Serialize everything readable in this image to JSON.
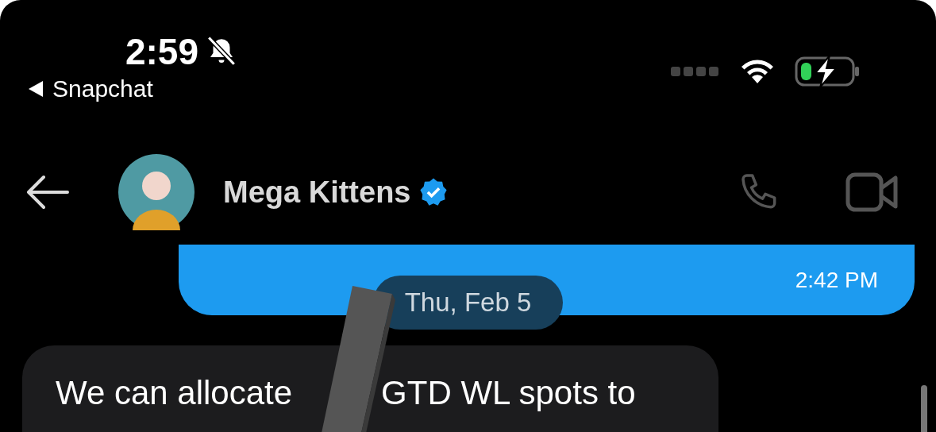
{
  "status_bar": {
    "time": "2:59",
    "back_app": "Snapchat"
  },
  "header": {
    "contact_name": "Mega Kittens",
    "verified": true
  },
  "messages": [
    {
      "kind": "sent",
      "time": "2:42 PM"
    },
    {
      "kind": "date",
      "text": "Thu, Feb 5"
    },
    {
      "kind": "received",
      "text_parts": [
        "We can allocate",
        "GTD WL spots to"
      ],
      "redacted": true
    }
  ]
}
